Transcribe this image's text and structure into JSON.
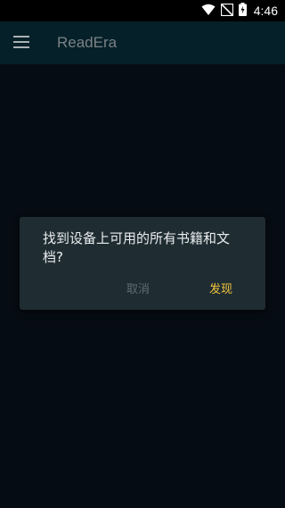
{
  "status_bar": {
    "time": "4:46",
    "icons": [
      "wifi-icon",
      "signal-off-icon",
      "battery-charging-icon"
    ]
  },
  "app_bar": {
    "title": "ReadEra",
    "menu_icon": "hamburger-menu-icon"
  },
  "dialog": {
    "message": "找到设备上可用的所有书籍和文档?",
    "cancel_label": "取消",
    "discover_label": "发现"
  },
  "colors": {
    "background": "#060c13",
    "app_bar": "#052028",
    "dialog": "#1f2d33",
    "accent": "#f1c33b",
    "disabled_text": "#5f6a70"
  }
}
